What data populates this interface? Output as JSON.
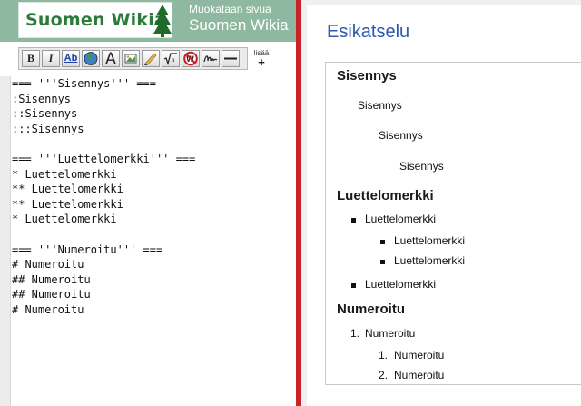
{
  "header": {
    "logo_text": "Suomen Wikia",
    "editing_label": "Muokataan sivua",
    "wiki_name": "Suomen Wikia"
  },
  "toolbar": {
    "bold_label": "B",
    "italic_label": "I",
    "link_label": "Ab",
    "headline_label": "A",
    "more_label": "lisää",
    "more_plus": "+"
  },
  "editor": {
    "lines": [
      "=== '''Sisennys''' ===",
      ":Sisennys",
      "::Sisennys",
      ":::Sisennys",
      "",
      "=== '''Luettelomerkki''' ===",
      "* Luettelomerkki",
      "** Luettelomerkki",
      "** Luettelomerkki",
      "* Luettelomerkki",
      "",
      "=== '''Numeroitu''' ===",
      "# Numeroitu",
      "## Numeroitu",
      "## Numeroitu",
      "# Numeroitu"
    ]
  },
  "preview": {
    "title": "Esikatselu",
    "heading_indent": "Sisennys",
    "indent_1": "Sisennys",
    "indent_2": "Sisennys",
    "indent_3": "Sisennys",
    "heading_bullets": "Luettelomerkki",
    "bullet_1": "Luettelomerkki",
    "bullet_1_1": "Luettelomerkki",
    "bullet_1_2": "Luettelomerkki",
    "bullet_2": "Luettelomerkki",
    "heading_numbered": "Numeroitu",
    "num_1_marker": "1.",
    "num_1": "Numeroitu",
    "num_1_1_marker": "1.",
    "num_1_1": "Numeroitu",
    "num_1_2_marker": "2.",
    "num_1_2": "Numeroitu"
  },
  "colors": {
    "header_bg": "#8fb8a0",
    "logo_green": "#2a7a3a",
    "divider_red": "#c92228",
    "preview_title_blue": "#2d57b0"
  }
}
